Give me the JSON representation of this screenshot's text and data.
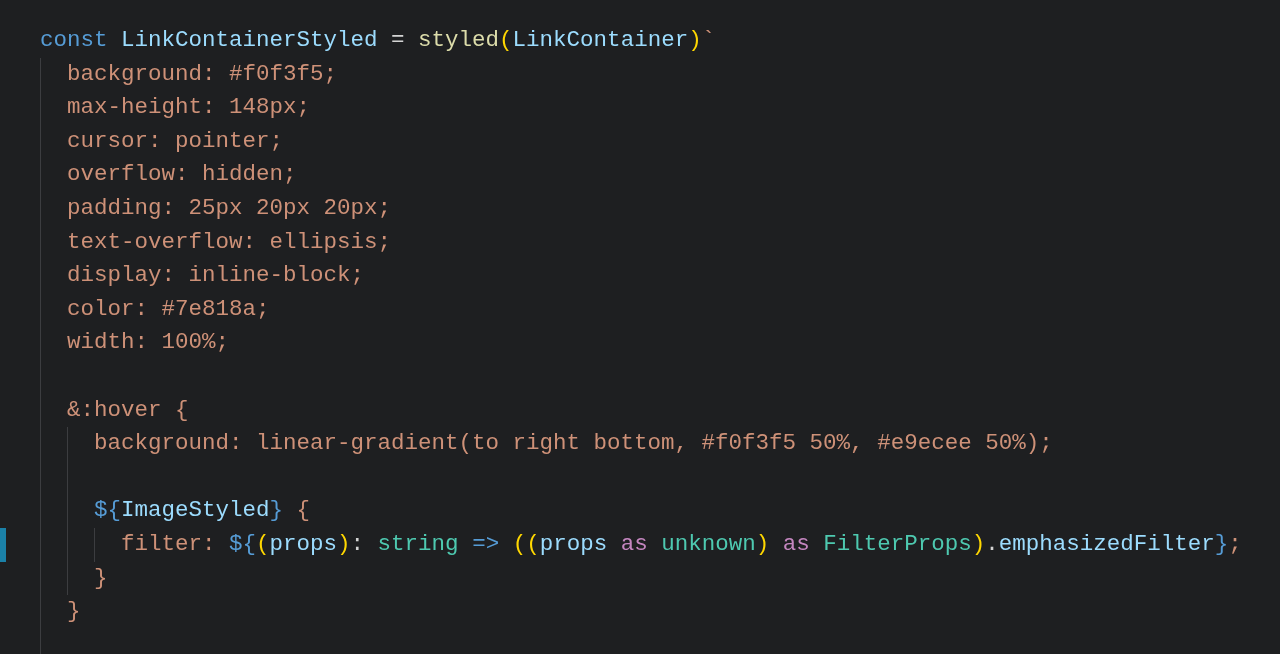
{
  "editor": {
    "lines": [
      {
        "kind": "code",
        "modified": false,
        "tokens": [
          {
            "text": "const ",
            "kind": "keyword"
          },
          {
            "text": "LinkContainerStyled",
            "kind": "variable"
          },
          {
            "text": " = ",
            "kind": "operator"
          },
          {
            "text": "styled",
            "kind": "function"
          },
          {
            "text": "(",
            "kind": "bracket"
          },
          {
            "text": "LinkContainer",
            "kind": "variable"
          },
          {
            "text": ")",
            "kind": "bracket"
          },
          {
            "text": "`",
            "kind": "css"
          }
        ],
        "children": [
          {
            "kind": "code",
            "modified": false,
            "tokens": [
              {
                "text": "background: #f0f3f5;",
                "kind": "css"
              }
            ]
          },
          {
            "kind": "code",
            "modified": false,
            "tokens": [
              {
                "text": "max-height: 148px;",
                "kind": "css"
              }
            ]
          },
          {
            "kind": "code",
            "modified": false,
            "tokens": [
              {
                "text": "cursor: pointer;",
                "kind": "css"
              }
            ]
          },
          {
            "kind": "code",
            "modified": false,
            "tokens": [
              {
                "text": "overflow: hidden;",
                "kind": "css"
              }
            ]
          },
          {
            "kind": "code",
            "modified": false,
            "tokens": [
              {
                "text": "padding: 25px 20px 20px;",
                "kind": "css"
              }
            ]
          },
          {
            "kind": "code",
            "modified": false,
            "tokens": [
              {
                "text": "text-overflow: ellipsis;",
                "kind": "css"
              }
            ]
          },
          {
            "kind": "code",
            "modified": false,
            "tokens": [
              {
                "text": "display: inline-block;",
                "kind": "css"
              }
            ]
          },
          {
            "kind": "code",
            "modified": false,
            "tokens": [
              {
                "text": "color: #7e818a;",
                "kind": "css"
              }
            ]
          },
          {
            "kind": "code",
            "modified": false,
            "tokens": [
              {
                "text": "width: 100%;",
                "kind": "css"
              }
            ]
          },
          {
            "kind": "blank"
          },
          {
            "kind": "code",
            "modified": false,
            "tokens": [
              {
                "text": "&:hover {",
                "kind": "css"
              }
            ],
            "children": [
              {
                "kind": "code",
                "modified": false,
                "tokens": [
                  {
                    "text": "background: linear-gradient(to right bottom, #f0f3f5 50%, #e9ecee 50%);",
                    "kind": "css"
                  }
                ]
              },
              {
                "kind": "blank"
              },
              {
                "kind": "code",
                "modified": false,
                "tokens": [
                  {
                    "text": "${",
                    "kind": "template"
                  },
                  {
                    "text": "ImageStyled",
                    "kind": "variable"
                  },
                  {
                    "text": "}",
                    "kind": "template"
                  },
                  {
                    "text": " {",
                    "kind": "css"
                  }
                ],
                "children": [
                  {
                    "kind": "code",
                    "modified": true,
                    "tokens": [
                      {
                        "text": "filter: ",
                        "kind": "css"
                      },
                      {
                        "text": "${",
                        "kind": "template"
                      },
                      {
                        "text": "(",
                        "kind": "bracket"
                      },
                      {
                        "text": "props",
                        "kind": "variable"
                      },
                      {
                        "text": ")",
                        "kind": "bracket"
                      },
                      {
                        "text": ": ",
                        "kind": "operator"
                      },
                      {
                        "text": "string",
                        "kind": "type"
                      },
                      {
                        "text": " => ",
                        "kind": "template"
                      },
                      {
                        "text": "((",
                        "kind": "bracket"
                      },
                      {
                        "text": "props",
                        "kind": "variable"
                      },
                      {
                        "text": " as ",
                        "kind": "cast"
                      },
                      {
                        "text": "unknown",
                        "kind": "type"
                      },
                      {
                        "text": ")",
                        "kind": "bracket"
                      },
                      {
                        "text": " as ",
                        "kind": "cast"
                      },
                      {
                        "text": "FilterProps",
                        "kind": "type"
                      },
                      {
                        "text": ")",
                        "kind": "bracket"
                      },
                      {
                        "text": ".",
                        "kind": "operator"
                      },
                      {
                        "text": "emphasizedFilter",
                        "kind": "variable"
                      },
                      {
                        "text": "}",
                        "kind": "template"
                      },
                      {
                        "text": ";",
                        "kind": "css"
                      }
                    ]
                  }
                ]
              },
              {
                "kind": "code",
                "modified": false,
                "tokens": [
                  {
                    "text": "}",
                    "kind": "css"
                  }
                ]
              }
            ]
          },
          {
            "kind": "code",
            "modified": false,
            "tokens": [
              {
                "text": "}",
                "kind": "css"
              }
            ]
          }
        ]
      }
    ]
  }
}
